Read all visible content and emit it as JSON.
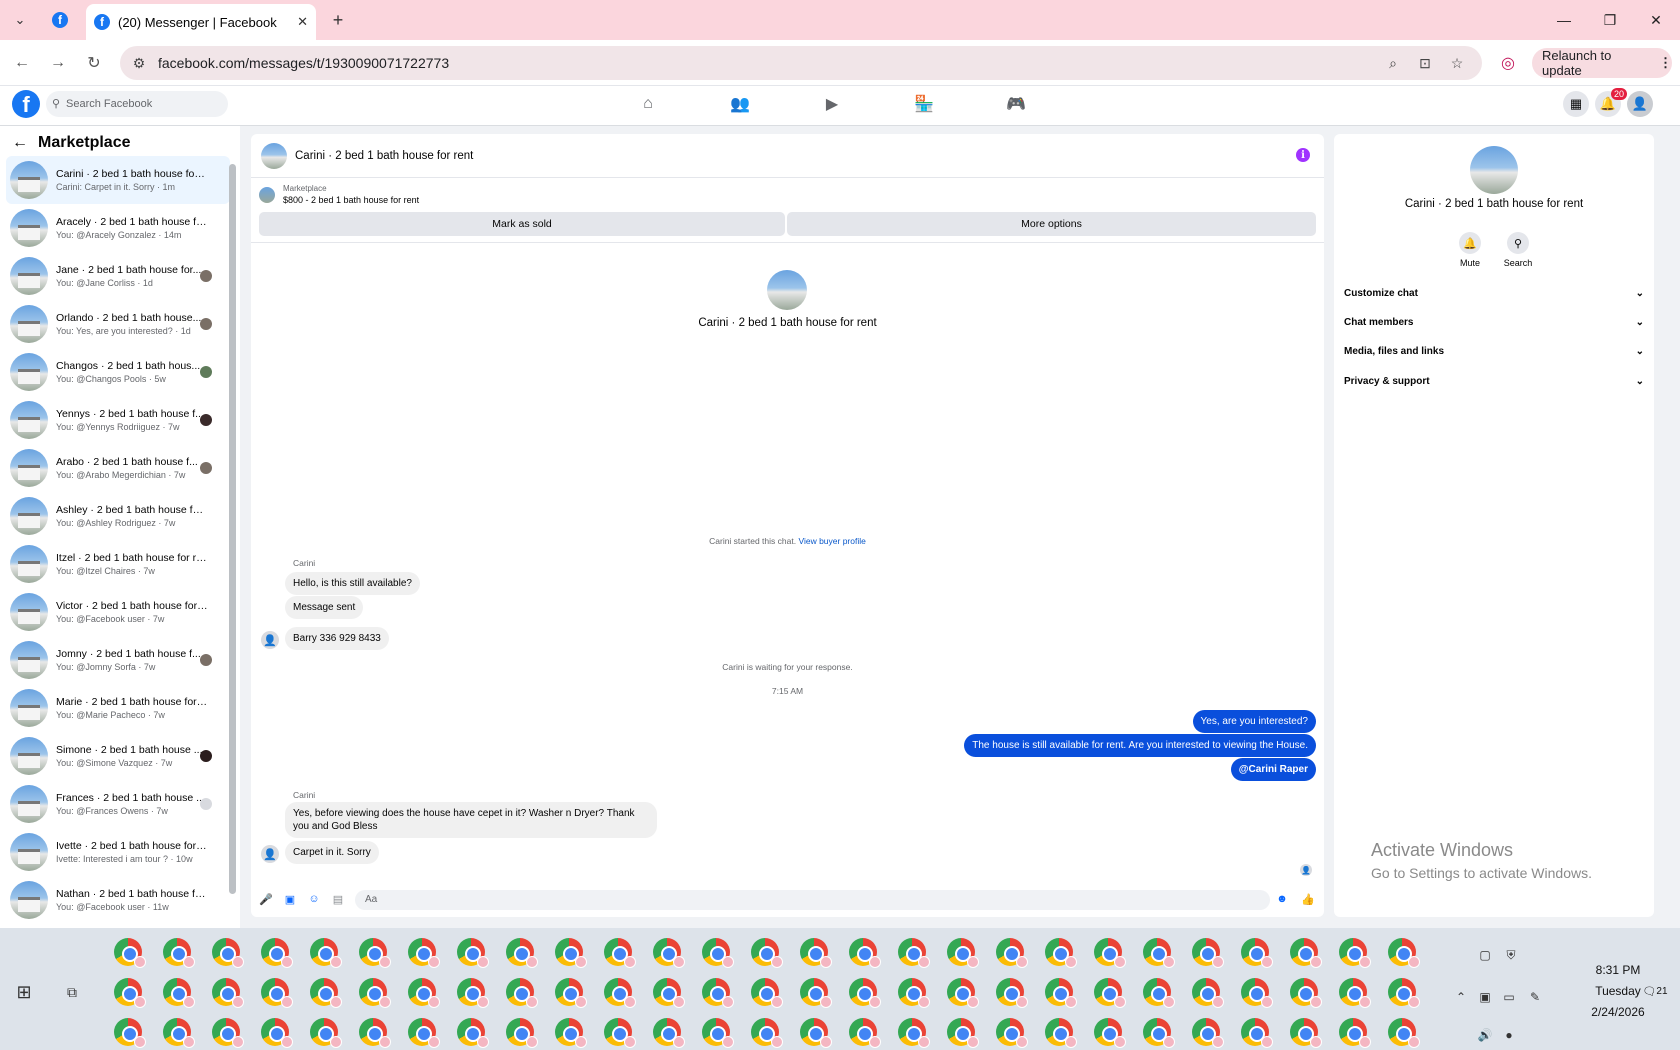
{
  "browser": {
    "tab_title": "(20) Messenger | Facebook",
    "url": "facebook.com/messages/t/1930090071722773",
    "relaunch_label": "Relaunch to update"
  },
  "fb": {
    "search_placeholder": "Search Facebook",
    "notification_count": "20"
  },
  "sidebar": {
    "title": "Marketplace",
    "conversations": [
      {
        "name": "Carini · 2 bed 1 bath house for r...",
        "sub": "Carini: Carpet in it. Sorry · 1m"
      },
      {
        "name": "Aracely · 2 bed 1 bath house fo...",
        "sub": "You: @Aracely Gonzalez · 14m"
      },
      {
        "name": "Jane · 2 bed 1 bath house for...",
        "sub": "You: @Jane Corliss · 1d"
      },
      {
        "name": "Orlando · 2 bed 1 bath house...",
        "sub": "You: Yes, are you interested? · 1d"
      },
      {
        "name": "Changos · 2 bed 1 bath hous...",
        "sub": "You: @Changos Pools · 5w"
      },
      {
        "name": "Yennys · 2 bed 1 bath house f...",
        "sub": "You: @Yennys Rodriiguez · 7w"
      },
      {
        "name": "Arabo · 2 bed 1 bath house f...",
        "sub": "You: @Arabo Megerdichian · 7w"
      },
      {
        "name": "Ashley · 2 bed 1 bath house for ...",
        "sub": "You: @Ashley Rodriguez · 7w"
      },
      {
        "name": "Itzel · 2 bed 1 bath house for rent",
        "sub": "You: @Itzel Chaires · 7w"
      },
      {
        "name": "Victor · 2 bed 1 bath house for ...",
        "sub": "You: @Facebook user · 7w"
      },
      {
        "name": "Jomny · 2 bed 1 bath house f...",
        "sub": "You: @Jomny Sorfa · 7w"
      },
      {
        "name": "Marie · 2 bed 1 bath house for r...",
        "sub": "You: @Marie Pacheco · 7w"
      },
      {
        "name": "Simone · 2 bed 1 bath house ...",
        "sub": "You: @Simone Vazquez · 7w"
      },
      {
        "name": "Frances · 2 bed 1 bath house ...",
        "sub": "You: @Frances Owens · 7w"
      },
      {
        "name": "Ivette · 2 bed 1 bath house for r...",
        "sub": "Ivette: Interested i am tour ? · 10w"
      },
      {
        "name": "Nathan · 2 bed 1 bath house fo...",
        "sub": "You: @Facebook user · 11w"
      }
    ]
  },
  "chat": {
    "title": "Carini · 2 bed 1 bath house for rent",
    "marketplace_label": "Marketplace",
    "listing": "$800 - 2 bed 1 bath house for rent",
    "mark_sold": "Mark as sold",
    "more_options": "More options",
    "started_text": "Carini started this chat.",
    "view_buyer": "View buyer profile",
    "sender1": "Carini",
    "msg1": "Hello, is this still available?",
    "msg2": "Message sent",
    "msg3": "Barry 336 929 8433",
    "waiting": "Carini is waiting for your response.",
    "time": "7:15 AM",
    "out1": "Yes, are you interested?",
    "out2": "The house is still available for rent. Are you interested to viewing  the House.",
    "out3": "@Carini Raper",
    "sender2": "Carini",
    "msg4": "Yes, before viewing does the house have cepet in it? Washer n Dryer? Thank you and God Bless",
    "msg5": "Carpet in it. Sorry",
    "composer_placeholder": "Aa"
  },
  "details": {
    "title": "Carini · 2 bed 1 bath house for rent",
    "mute": "Mute",
    "search": "Search",
    "sections": [
      "Customize chat",
      "Chat members",
      "Media, files and links",
      "Privacy & support"
    ]
  },
  "watermark": {
    "line1": "Activate Windows",
    "line2": "Go to Settings to activate Windows."
  },
  "taskbar": {
    "time": "8:31 PM",
    "day": "Tuesday",
    "date": "2/24/2026",
    "notif_count": "21"
  }
}
